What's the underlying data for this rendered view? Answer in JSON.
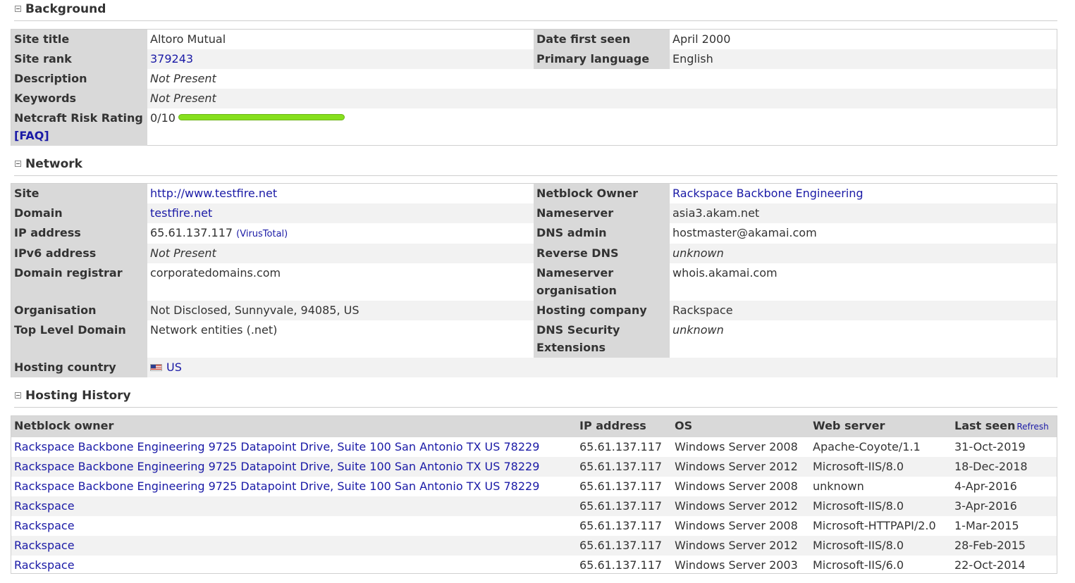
{
  "background": {
    "title": "Background",
    "site_title_label": "Site title",
    "site_title": "Altoro Mutual",
    "date_first_seen_label": "Date first seen",
    "date_first_seen": "April 2000",
    "site_rank_label": "Site rank",
    "site_rank": "379243",
    "primary_language_label": "Primary language",
    "primary_language": "English",
    "description_label": "Description",
    "description": "Not Present",
    "keywords_label": "Keywords",
    "keywords": "Not Present",
    "risk_label": "Netcraft Risk Rating",
    "risk_faq": "[FAQ]",
    "risk_value": "0/10",
    "risk_bar_fraction": 1.0,
    "risk_bar_color": "#86e01e"
  },
  "network": {
    "title": "Network",
    "site_label": "Site",
    "site": "http://www.testfire.net",
    "netblock_owner_label": "Netblock Owner",
    "netblock_owner": "Rackspace Backbone Engineering",
    "domain_label": "Domain",
    "domain": "testfire.net",
    "nameserver_label": "Nameserver",
    "nameserver": "asia3.akam.net",
    "ip_label": "IP address",
    "ip": "65.61.137.117",
    "virustotal_open": "(",
    "virustotal": "VirusTotal",
    "virustotal_close": ")",
    "dns_admin_label": "DNS admin",
    "dns_admin": "hostmaster@akamai.com",
    "ipv6_label": "IPv6 address",
    "ipv6": "Not Present",
    "reverse_dns_label": "Reverse DNS",
    "reverse_dns": "unknown",
    "registrar_label": "Domain registrar",
    "registrar": "corporatedomains.com",
    "ns_org_label": "Nameserver organisation",
    "ns_org": "whois.akamai.com",
    "organisation_label": "Organisation",
    "organisation": "Not Disclosed, Sunnyvale, 94085, US",
    "hosting_company_label": "Hosting company",
    "hosting_company": "Rackspace",
    "tld_label": "Top Level Domain",
    "tld": "Network entities (.net)",
    "dnssec_label": "DNS Security Extensions",
    "dnssec": "unknown",
    "hosting_country_label": "Hosting country",
    "hosting_country": "US"
  },
  "history": {
    "title": "Hosting History",
    "columns": {
      "owner": "Netblock owner",
      "ip": "IP address",
      "os": "OS",
      "server": "Web server",
      "last_seen": "Last seen",
      "refresh": "Refresh"
    },
    "rows": [
      {
        "owner": "Rackspace Backbone Engineering 9725 Datapoint Drive, Suite 100 San Antonio TX US 78229",
        "ip": "65.61.137.117",
        "os": "Windows Server 2008",
        "server": "Apache-Coyote/1.1",
        "last_seen": "31-Oct-2019"
      },
      {
        "owner": "Rackspace Backbone Engineering 9725 Datapoint Drive, Suite 100 San Antonio TX US 78229",
        "ip": "65.61.137.117",
        "os": "Windows Server 2012",
        "server": "Microsoft-IIS/8.0",
        "last_seen": "18-Dec-2018"
      },
      {
        "owner": "Rackspace Backbone Engineering 9725 Datapoint Drive, Suite 100 San Antonio TX US 78229",
        "ip": "65.61.137.117",
        "os": "Windows Server 2008",
        "server": "unknown",
        "last_seen": "4-Apr-2016"
      },
      {
        "owner": "Rackspace",
        "ip": "65.61.137.117",
        "os": "Windows Server 2012",
        "server": "Microsoft-IIS/8.0",
        "last_seen": "3-Apr-2016"
      },
      {
        "owner": "Rackspace",
        "ip": "65.61.137.117",
        "os": "Windows Server 2008",
        "server": "Microsoft-HTTPAPI/2.0",
        "last_seen": "1-Mar-2015"
      },
      {
        "owner": "Rackspace",
        "ip": "65.61.137.117",
        "os": "Windows Server 2012",
        "server": "Microsoft-IIS/8.0",
        "last_seen": "28-Feb-2015"
      },
      {
        "owner": "Rackspace",
        "ip": "65.61.137.117",
        "os": "Windows Server 2003",
        "server": "Microsoft-IIS/6.0",
        "last_seen": "22-Oct-2014"
      }
    ]
  }
}
